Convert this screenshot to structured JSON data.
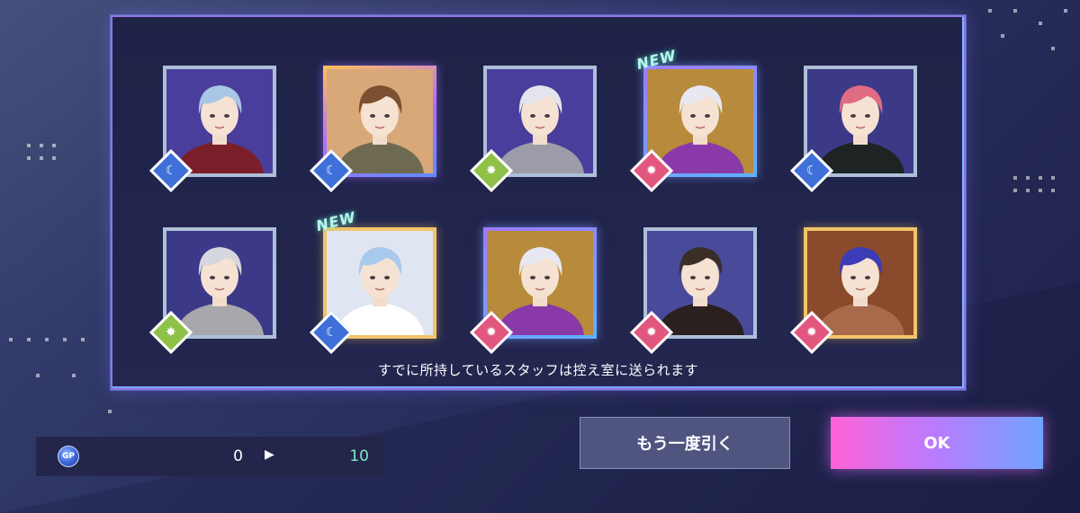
{
  "screen": {
    "notice": "すでに所持しているスタッフは控え室に送られます"
  },
  "cards": [
    {
      "attribute": "moon",
      "is_new": false,
      "frame": "normal",
      "hair": "#a9c6e6",
      "bg": "#4a3e9c",
      "outfit": "#7a1f2a"
    },
    {
      "attribute": "moon",
      "is_new": false,
      "frame": "rare",
      "hair": "#7a5030",
      "bg": "#d8a878",
      "outfit": "#6e6a52"
    },
    {
      "attribute": "star",
      "is_new": false,
      "frame": "normal",
      "hair": "#e4e4ee",
      "bg": "#4a3e9c",
      "outfit": "#9c9ca8"
    },
    {
      "attribute": "sun",
      "is_new": true,
      "frame": "blue",
      "hair": "#e8e8f2",
      "bg": "#b88a3c",
      "outfit": "#8a3aa8"
    },
    {
      "attribute": "moon",
      "is_new": false,
      "frame": "normal",
      "hair": "#e06c84",
      "bg": "#3c3a88",
      "outfit": "#1e2424"
    },
    {
      "attribute": "star",
      "is_new": false,
      "frame": "normal",
      "hair": "#d6d6de",
      "bg": "#3c3a88",
      "outfit": "#a8a8ac"
    },
    {
      "attribute": "moon",
      "is_new": true,
      "frame": "gold",
      "hair": "#a8c8ec",
      "bg": "#dfe6f2",
      "outfit": "#ffffff"
    },
    {
      "attribute": "sun",
      "is_new": false,
      "frame": "blue",
      "hair": "#e8e8f2",
      "bg": "#b88a3c",
      "outfit": "#8a3aa8"
    },
    {
      "attribute": "sun",
      "is_new": false,
      "frame": "normal",
      "hair": "#3a2e28",
      "bg": "#4a4a9a",
      "outfit": "#2a2020"
    },
    {
      "attribute": "sun",
      "is_new": false,
      "frame": "gold",
      "hair": "#3c3cb8",
      "bg": "#8a4a2c",
      "outfit": "#a86a4a"
    }
  ],
  "new_label": "NEW",
  "badge_glyphs": {
    "moon": "☾",
    "star": "✸",
    "sun": "✹"
  },
  "gp": {
    "icon_label": "GP",
    "current": "0",
    "after": "10"
  },
  "buttons": {
    "retry_label": "もう一度引く",
    "ok_label": "OK"
  }
}
